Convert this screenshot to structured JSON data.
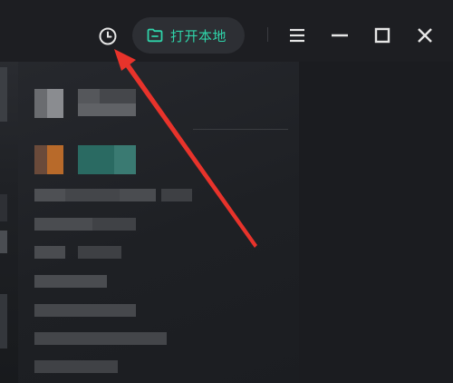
{
  "titlebar": {
    "history_icon": "clock-icon",
    "open_local_label": "打开本地",
    "open_local_icon": "folder-icon",
    "menu_icon": "hamburger-icon",
    "minimize_icon": "minimize-icon",
    "maximize_icon": "maximize-icon",
    "close_icon": "close-icon"
  },
  "colors": {
    "accent": "#2fd3a9",
    "annotation_arrow": "#e8332b",
    "background": "#1d1e22",
    "button_bg": "#2d2f34"
  },
  "annotation": {
    "type": "arrow",
    "target": "history-button"
  }
}
